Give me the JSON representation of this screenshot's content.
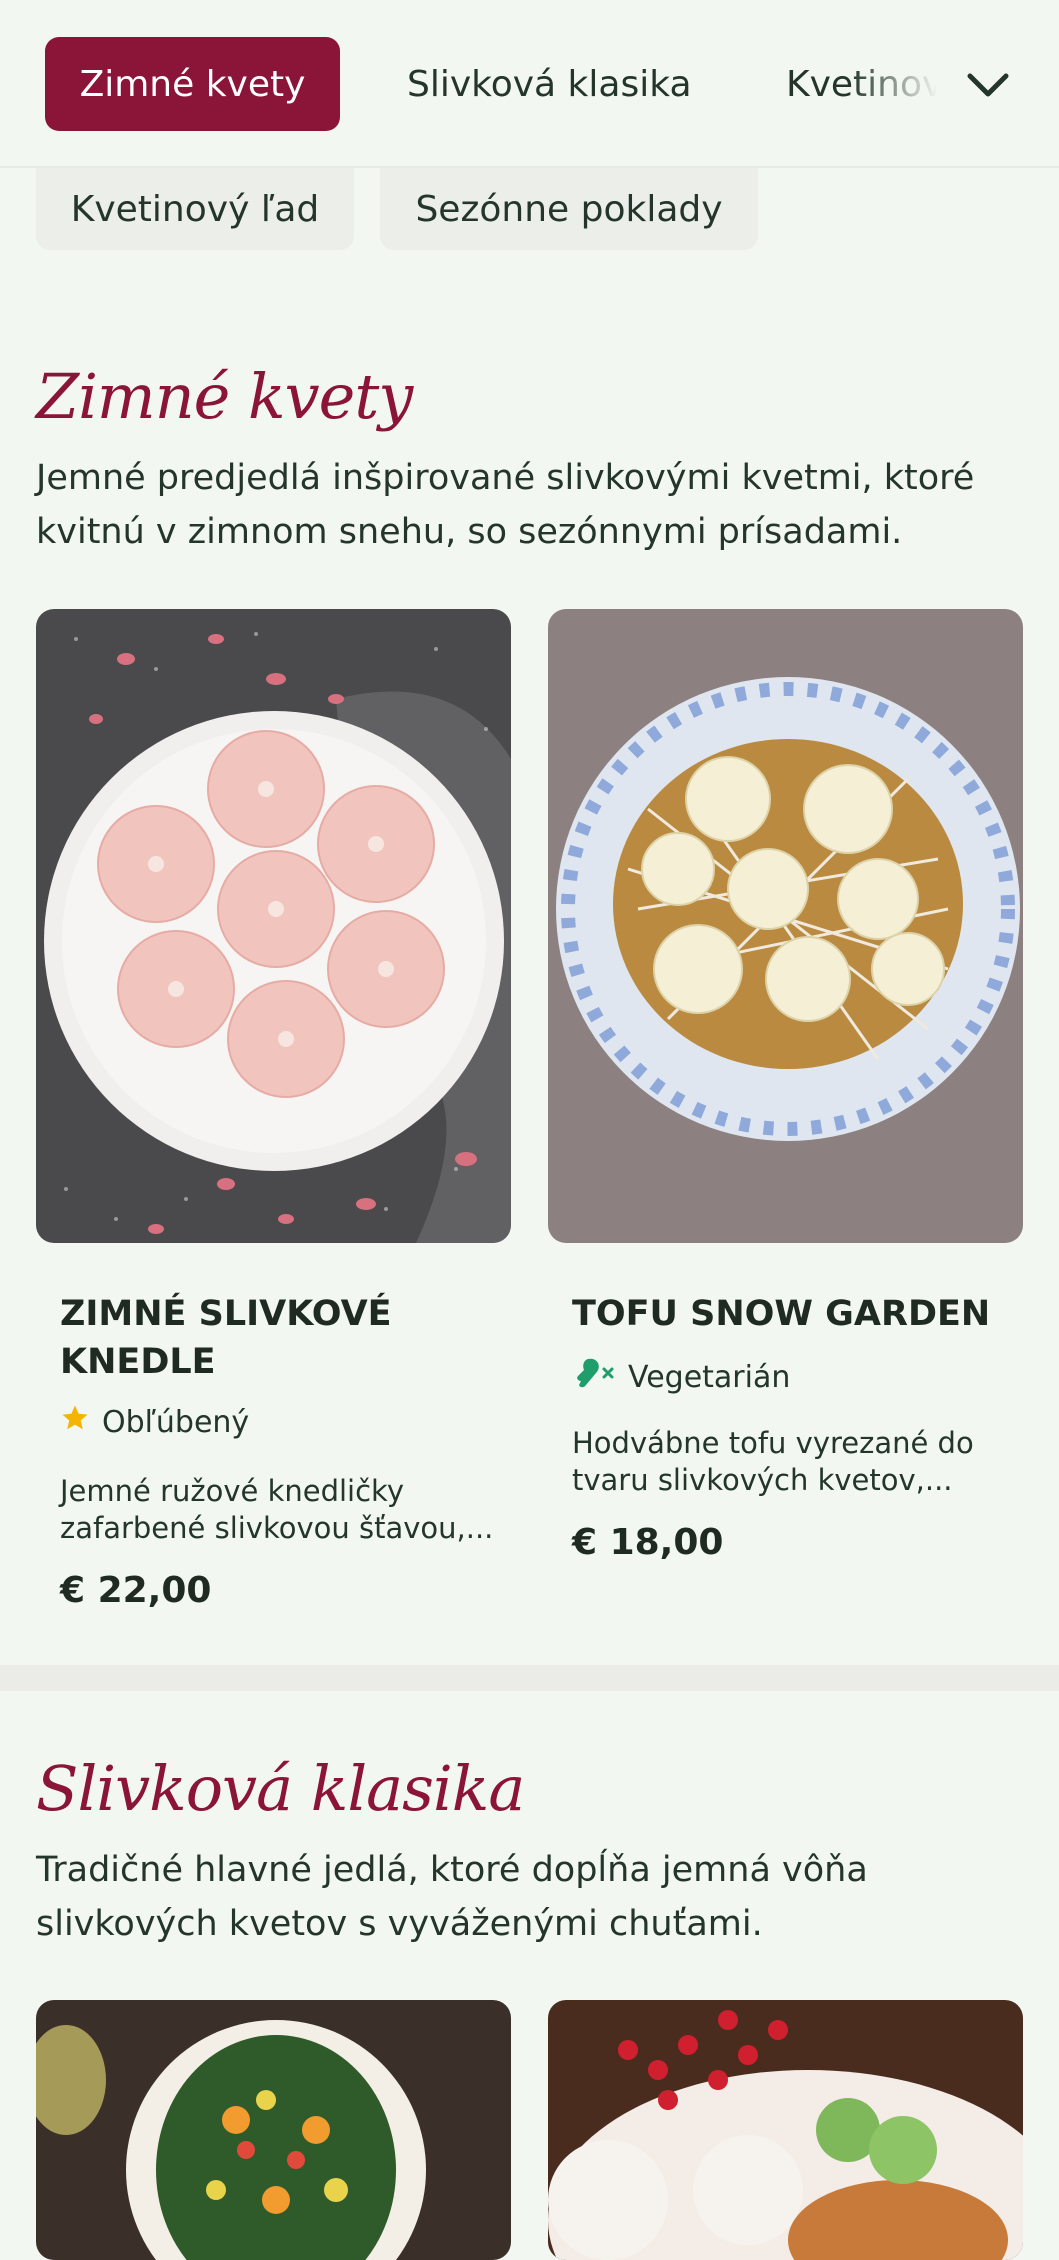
{
  "nav": {
    "tabs": [
      {
        "label": "Zimné kvety",
        "active": true
      },
      {
        "label": "Slivková klasika",
        "active": false
      },
      {
        "label": "Kvetinov",
        "active": false
      }
    ],
    "row2": [
      {
        "label": "Kvetinový ľad"
      },
      {
        "label": "Sezónne poklady"
      }
    ],
    "expand_icon": "chevron-down-icon",
    "accent": "#8a1538"
  },
  "sections": [
    {
      "title": "Zimné kvety",
      "description": "Jemné predjedlá inšpirované slivkovými kvetmi, ktoré kvitnú v zimnom snehu, so sezónnymi prísadami.",
      "items": [
        {
          "name": "ZIMNÉ SLIVKOVÉ KNEDLE",
          "tag": "Obľúbený",
          "tag_icon": "star-icon",
          "description": "Jemné ružové knedličky zafarbené slivkovou šťavou,...",
          "price": "€ 22,00"
        },
        {
          "name": "TOFU SNOW GARDEN",
          "tag": "Vegetarián",
          "tag_icon": "vegetarian-leg-icon",
          "description": "Hodvábne tofu vyrezané do tvaru slivkových kvetov,...",
          "price": "€ 18,00"
        }
      ]
    },
    {
      "title": "Slivková klasika",
      "description": "Tradičné hlavné jedlá, ktoré dopĺňa jemná vôňa slivkových kvetov s vyváženými chuťami."
    }
  ]
}
